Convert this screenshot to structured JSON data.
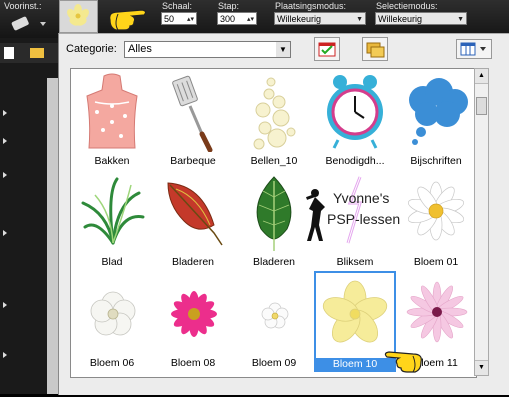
{
  "toolbar": {
    "preset_label": "Voorinst.:",
    "scale_label": "Schaal:",
    "scale_value": "50",
    "step_label": "Stap:",
    "step_value": "300",
    "placement_label": "Plaatsingsmodus:",
    "placement_value": "Willekeurig",
    "selection_label": "Selectiemodus:",
    "selection_value": "Willekeurig"
  },
  "popup": {
    "category_label": "Categorie:",
    "category_value": "Alles"
  },
  "items": [
    {
      "name": "Bakken"
    },
    {
      "name": "Barbeque"
    },
    {
      "name": "Bellen_10"
    },
    {
      "name": "Benodigdh..."
    },
    {
      "name": "Bijschriften"
    },
    {
      "name": "Blad"
    },
    {
      "name": "Bladeren"
    },
    {
      "name": "Bladeren"
    },
    {
      "name": "Bliksem"
    },
    {
      "name": "Bloem 01"
    },
    {
      "name": "Bloem 06"
    },
    {
      "name": "Bloem 08"
    },
    {
      "name": "Bloem 09"
    },
    {
      "name": "Bloem 10"
    },
    {
      "name": "Bloem 11"
    }
  ],
  "watermark": {
    "line1": "Yvonne's",
    "line2": "PSP-lessen"
  }
}
